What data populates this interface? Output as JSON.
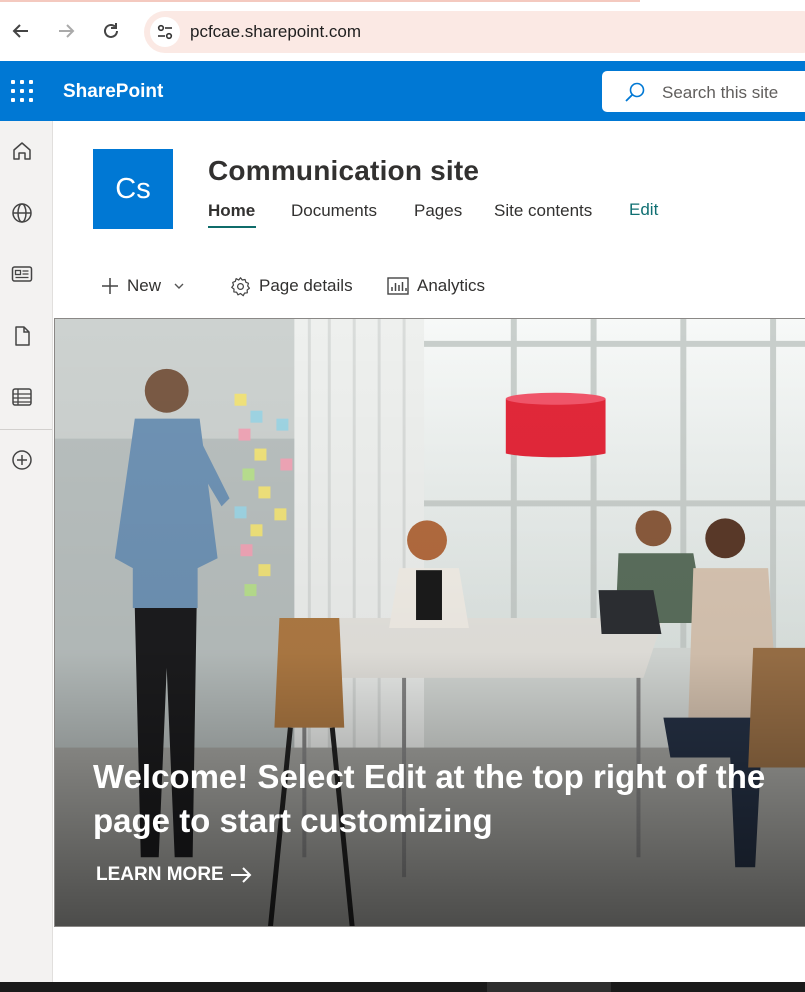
{
  "browser": {
    "url": "pcfcae.sharepoint.com"
  },
  "suitebar": {
    "brand": "SharePoint",
    "search_placeholder": "Search this site"
  },
  "appbar": {
    "icons": [
      "home-icon",
      "globe-icon",
      "news-icon",
      "document-icon",
      "list-icon",
      "add-icon"
    ]
  },
  "site": {
    "logo_text": "Cs",
    "title": "Communication site",
    "nav": [
      "Home",
      "Documents",
      "Pages",
      "Site contents"
    ],
    "edit_label": "Edit"
  },
  "commandbar": {
    "new_label": "New",
    "page_details_label": "Page details",
    "analytics_label": "Analytics"
  },
  "hero": {
    "title": "Welcome! Select Edit at the top right of the page to start customizing",
    "learn_more": "LEARN MORE"
  },
  "colors": {
    "suite_blue": "#0078d4",
    "accent_teal": "#0f6c6a"
  }
}
